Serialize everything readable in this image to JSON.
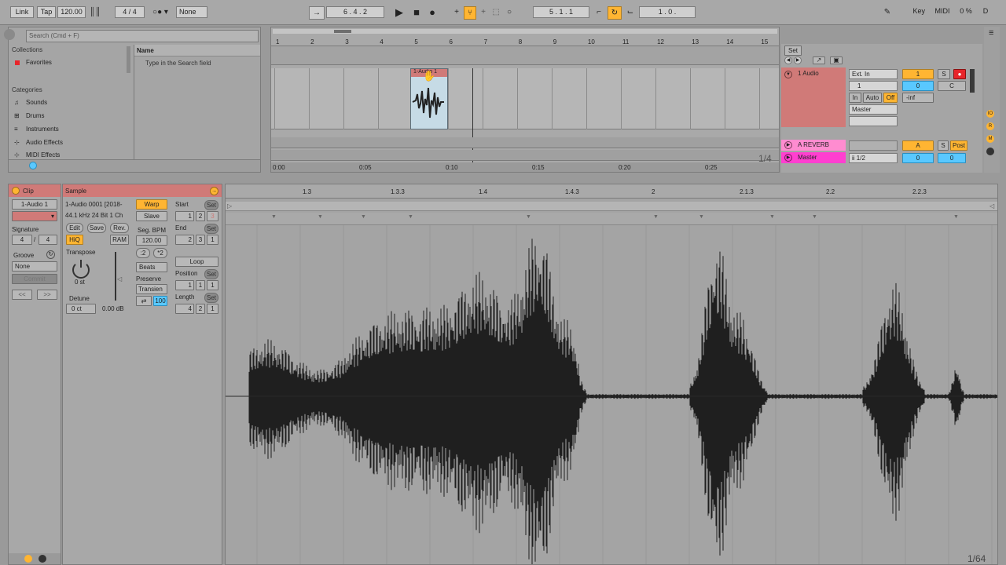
{
  "toolbar": {
    "link": "Link",
    "tap": "Tap",
    "tempo": "120.00",
    "metro_icon": "metronome-bars-icon",
    "signature": "4 / 4",
    "quantize_icon": "quantize-dots-icon",
    "quantize": "None",
    "follow_icon": "follow-arrow-icon",
    "arrangement_position": "6 .  4 .  2",
    "play_icon": "play-icon",
    "stop_icon": "stop-icon",
    "record_icon": "record-icon",
    "add_icon": "plus-icon",
    "automation_icon": "automation-arm-icon",
    "punch_icon": "punch-icon",
    "session_record_icon": "session-record-icon",
    "loop_start": "5 .  1 .  1",
    "loop_icon": "loop-icon",
    "punch_in_icon": "punch-in-icon",
    "loop_length": "1 .  0 .",
    "draw_icon": "pencil-icon",
    "key": "Key",
    "midi": "MIDI",
    "cpu": "0 %",
    "disk": "D"
  },
  "browser": {
    "search_placeholder": "Search (Cmd + F)",
    "collections_header": "Collections",
    "favorites": "Favorites",
    "categories_header": "Categories",
    "categories": [
      "Sounds",
      "Drums",
      "Instruments",
      "Audio Effects",
      "MIDI Effects"
    ],
    "name_header": "Name",
    "hint": "Type in the Search field"
  },
  "arrangement": {
    "bar_numbers": [
      "1",
      "2",
      "3",
      "4",
      "5",
      "6",
      "7",
      "8",
      "9",
      "10",
      "11",
      "12",
      "13",
      "14",
      "15"
    ],
    "time_labels": [
      "0:00",
      "0:05",
      "0:10",
      "0:15",
      "0:20",
      "0:25"
    ],
    "zoom": "1/4",
    "set_button": "Set",
    "clip_name": "1-Audio 1"
  },
  "tracks": [
    {
      "name": "1 Audio",
      "input_type": "Ext. In",
      "input_channel": "1",
      "monitor": [
        "In",
        "Auto",
        "Off"
      ],
      "output": "Master",
      "number": "1",
      "solo": "S",
      "volume": "0",
      "pan": "C",
      "meter": "-inf"
    },
    {
      "name": "A REVERB",
      "letter": "A",
      "solo": "S",
      "post": "Post"
    },
    {
      "name": "Master",
      "output": "ii 1/2",
      "volume": "0",
      "volume2": "0"
    }
  ],
  "clip_panel": {
    "title": "Clip",
    "clip_name": "1-Audio 1",
    "signature_label": "Signature",
    "sig_num": "4",
    "sig_den": "4",
    "groove_label": "Groove",
    "groove": "None",
    "commit": "Commit",
    "nav_left": "<<",
    "nav_right": ">>"
  },
  "sample_panel": {
    "title": "Sample",
    "file_name": "1-Audio 0001 [2018-",
    "file_info": "44.1 kHz 24 Bit 1 Ch",
    "edit": "Edit",
    "save": "Save",
    "rev": "Rev.",
    "hiq": "HiQ",
    "ram": "RAM",
    "transpose_label": "Transpose",
    "transpose": "0 st",
    "detune_label": "Detune",
    "detune": "0 ct",
    "gain": "0.00 dB",
    "warp": "Warp",
    "slave": "Slave",
    "seg_bpm_label": "Seg. BPM",
    "seg_bpm": "120.00",
    "half": ":2",
    "double": "*2",
    "warp_mode": "Beats",
    "preserve_label": "Preserve",
    "preserve": "Transien",
    "loop_mode_value": "100",
    "start_label": "Start",
    "start_vals": [
      "1",
      "2",
      "3"
    ],
    "end_label": "End",
    "end_vals": [
      "2",
      "3",
      "1"
    ],
    "loop": "Loop",
    "position_label": "Position",
    "position_vals": [
      "1",
      "1",
      "1"
    ],
    "length_label": "Length",
    "length_vals": [
      "4",
      "2",
      "1"
    ],
    "set": "Set"
  },
  "sample_editor": {
    "ruler": [
      "1.3",
      "1.3.3",
      "1.4",
      "1.4.3",
      "2",
      "2.1.3",
      "2.2",
      "2.2.3"
    ],
    "zoom": "1/64"
  },
  "colors": {
    "accent_orange": "#ffb532",
    "accent_blue": "#59c8ff",
    "clip_red": "#d07a78",
    "master_pink": "#ff3fd0"
  }
}
